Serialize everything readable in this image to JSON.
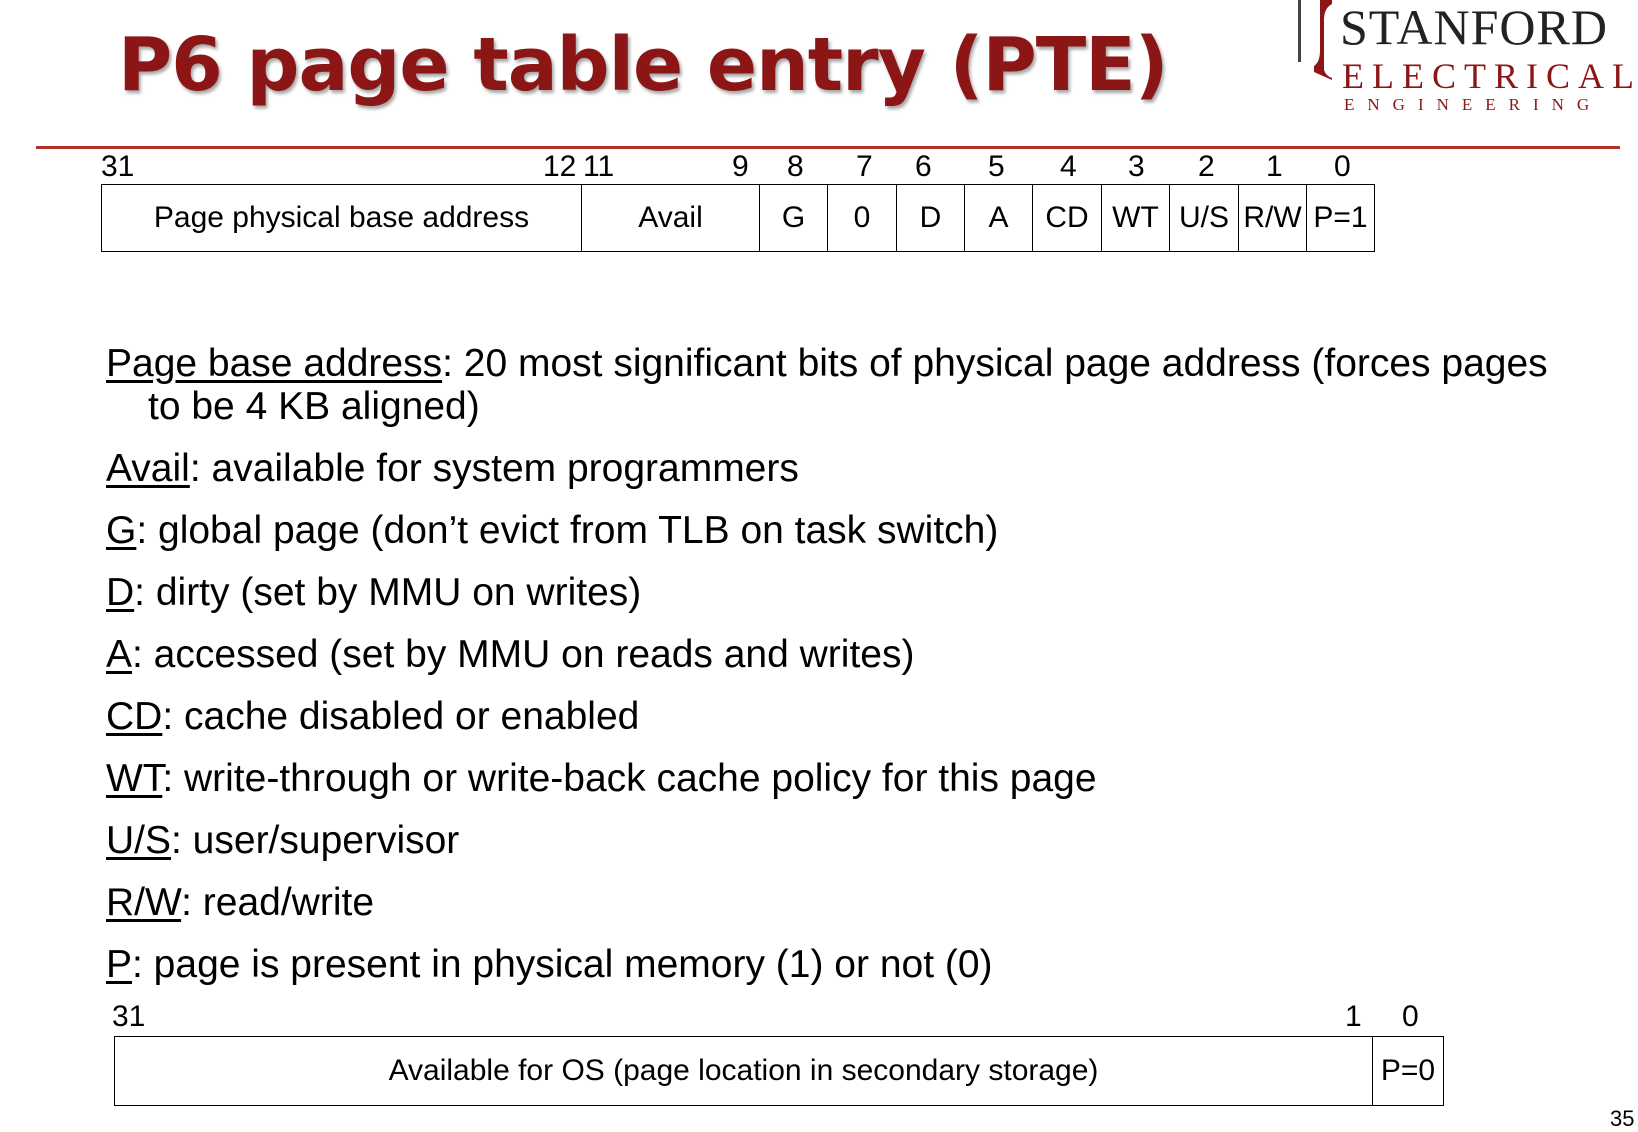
{
  "title": "P6 page table entry (PTE)",
  "logo": {
    "line1": "STANFORD",
    "line2": "ELECTRICAL",
    "line3": "ENGINEERING"
  },
  "colors": {
    "title": "#8c1515",
    "rule": "#b0302a",
    "text": "#000000"
  },
  "pte_present": {
    "bit_labels": {
      "b31": "31",
      "b12": "12",
      "b11": "11",
      "b9": "9",
      "b8": "8",
      "b7": "7",
      "b6": "6",
      "b5": "5",
      "b4": "4",
      "b3": "3",
      "b2": "2",
      "b1": "1",
      "b0": "0"
    },
    "fields": [
      "Page physical base address",
      "Avail",
      "G",
      "0",
      "D",
      "A",
      "CD",
      "WT",
      "U/S",
      "R/W",
      "P=1"
    ]
  },
  "definitions": [
    {
      "term": "Page base address",
      "text": ": 20 most significant bits of physical page address (forces pages to be 4 KB aligned)"
    },
    {
      "term": "Avail",
      "text": ": available for system programmers"
    },
    {
      "term": "G",
      "text": ": global page (don’t evict from TLB on task switch)"
    },
    {
      "term": "D",
      "text": ": dirty (set by MMU on writes)"
    },
    {
      "term": "A",
      "text": ": accessed (set by MMU on reads and writes)"
    },
    {
      "term": "CD",
      "text": ": cache disabled or enabled"
    },
    {
      "term": "WT",
      "text": ": write-through or write-back cache policy for this page"
    },
    {
      "term": "U/S",
      "text": ": user/supervisor"
    },
    {
      "term": "R/W",
      "text": ": read/write"
    },
    {
      "term": "P",
      "text": ": page is present in physical memory (1) or not (0)"
    }
  ],
  "pte_absent": {
    "bit_labels": {
      "b31": "31",
      "b1": "1",
      "b0": "0"
    },
    "fields": [
      "Available for OS (page location in secondary storage)",
      "P=0"
    ]
  },
  "page_number": "35"
}
